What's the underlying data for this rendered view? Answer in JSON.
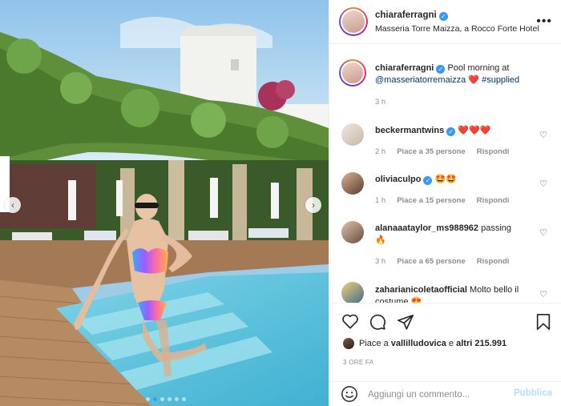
{
  "colors": {
    "accent_blue": "#3897f0",
    "publish_disabled": "#b2dffc",
    "heart_red": "#ed4956",
    "muted": "#8e8e8e"
  },
  "carousel": {
    "prev_icon": "chevron-left-icon",
    "next_icon": "chevron-right-icon",
    "page_count": 6,
    "active_index": 1
  },
  "header": {
    "username": "chiaraferragni",
    "location": "Masseria Torre Maizza, a Rocco Forte Hotel",
    "verified_icon": "verified-badge-icon",
    "more_icon": "more-options-icon"
  },
  "caption": {
    "username": "chiaraferragni",
    "text": "Pool morning at",
    "mention": "@masseriatorremaizza",
    "emoji": "❤️",
    "hashtag": "#supplied",
    "time": "3 h"
  },
  "comments": [
    {
      "username": "beckermantwins",
      "text": "",
      "emoji": "❤️❤️❤️",
      "time": "2 h",
      "likes": "Piace a 35 persone",
      "reply": "Rispondi"
    },
    {
      "username": "oliviaculpo",
      "text": "",
      "emoji": "🤩🤩",
      "time": "1 h",
      "likes": "Piace a 15 persone",
      "reply": "Rispondi"
    },
    {
      "username": "alanaaataylor_ms988962",
      "text": "passing",
      "emoji": "🔥",
      "time": "3 h",
      "likes": "Piace a 65 persone",
      "reply": "Rispondi"
    },
    {
      "username": "zaharianicoletaofficial",
      "text": "Molto bello il costume",
      "emoji": "😍",
      "time": "",
      "likes": "",
      "reply": ""
    }
  ],
  "actions": {
    "like_icon": "heart-icon",
    "comment_icon": "comment-icon",
    "share_icon": "share-icon",
    "save_icon": "bookmark-icon"
  },
  "likes": {
    "prefix": "Piace a",
    "user": "vallilludovica",
    "middle": "e",
    "others": "altri 215.991"
  },
  "timeago": "3 ORE FA",
  "composer": {
    "emoji_icon": "smiley-icon",
    "placeholder": "Aggiungi un commento...",
    "publish_label": "Pubblica"
  }
}
